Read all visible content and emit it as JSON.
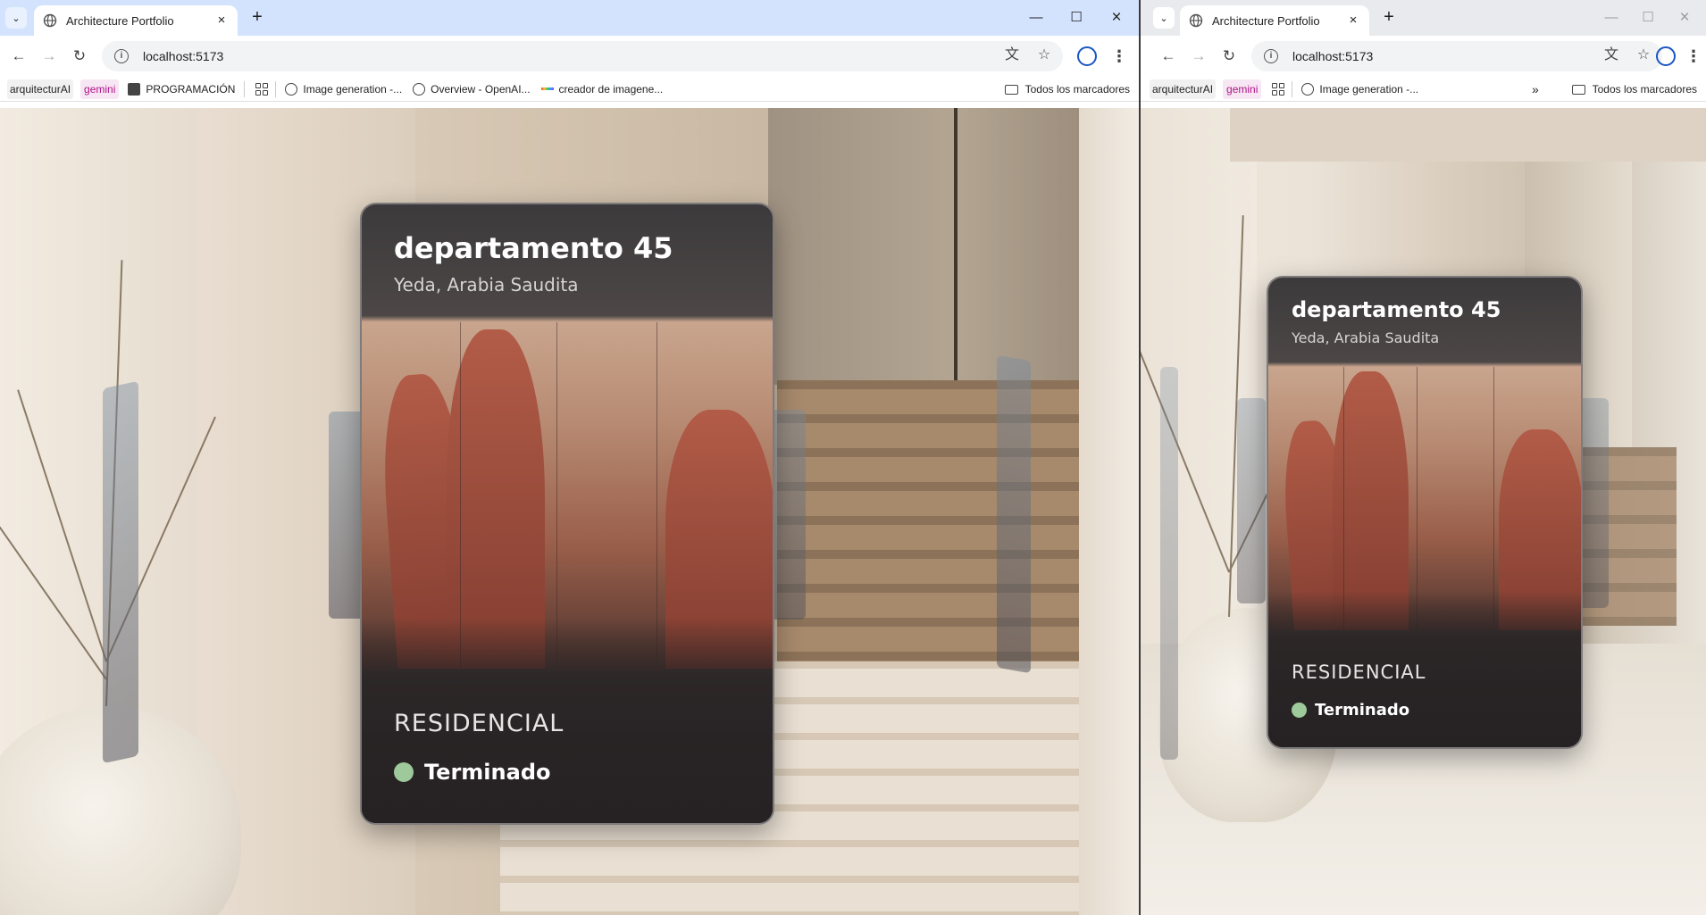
{
  "windows": [
    {
      "id": "left",
      "tab": {
        "title": "Architecture Portfolio"
      },
      "url": "localhost:5173",
      "bookmarks": [
        {
          "label": "arquitecturAI",
          "kind": "chip"
        },
        {
          "label": "gemini",
          "kind": "gemini"
        },
        {
          "label": "PROGRAMACIÓN",
          "kind": "folder-dark"
        },
        {
          "label": "Image generation -...",
          "kind": "openai"
        },
        {
          "label": "Overview - OpenAI...",
          "kind": "openai"
        },
        {
          "label": "creador de imagene...",
          "kind": "rainbow"
        }
      ],
      "all_bookmarks": "Todos los marcadores",
      "card": {
        "title": "departamento 45",
        "location": "Yeda, Arabia Saudita",
        "category": "RESIDENCIAL",
        "status": "Terminado",
        "status_color": "#9ec99a"
      }
    },
    {
      "id": "right",
      "tab": {
        "title": "Architecture Portfolio"
      },
      "url": "localhost:5173",
      "bookmarks": [
        {
          "label": "arquitecturAI",
          "kind": "chip"
        },
        {
          "label": "gemini",
          "kind": "gemini"
        },
        {
          "label": "Image generation -...",
          "kind": "openai"
        }
      ],
      "all_bookmarks": "Todos los marcadores",
      "card": {
        "title": "departamento 45",
        "location": "Yeda, Arabia Saudita",
        "category": "RESIDENCIAL",
        "status": "Terminado",
        "status_color": "#9ec99a"
      }
    }
  ],
  "icons": {
    "tab_list": "chevron-down-icon",
    "site": "globe-icon",
    "close_tab": "close-icon",
    "new_tab": "plus-icon",
    "minimize": "minimize-icon",
    "maximize": "maximize-icon",
    "close_window": "close-window-icon",
    "back": "arrow-left-icon",
    "forward": "arrow-right-icon",
    "reload": "reload-icon",
    "site_info": "info-icon",
    "translate": "translate-icon",
    "bookmark_star": "star-icon",
    "profile": "profile-icon",
    "menu": "kebab-menu-icon",
    "apps": "apps-grid-icon",
    "more_bookmarks": "double-chevron-icon"
  }
}
